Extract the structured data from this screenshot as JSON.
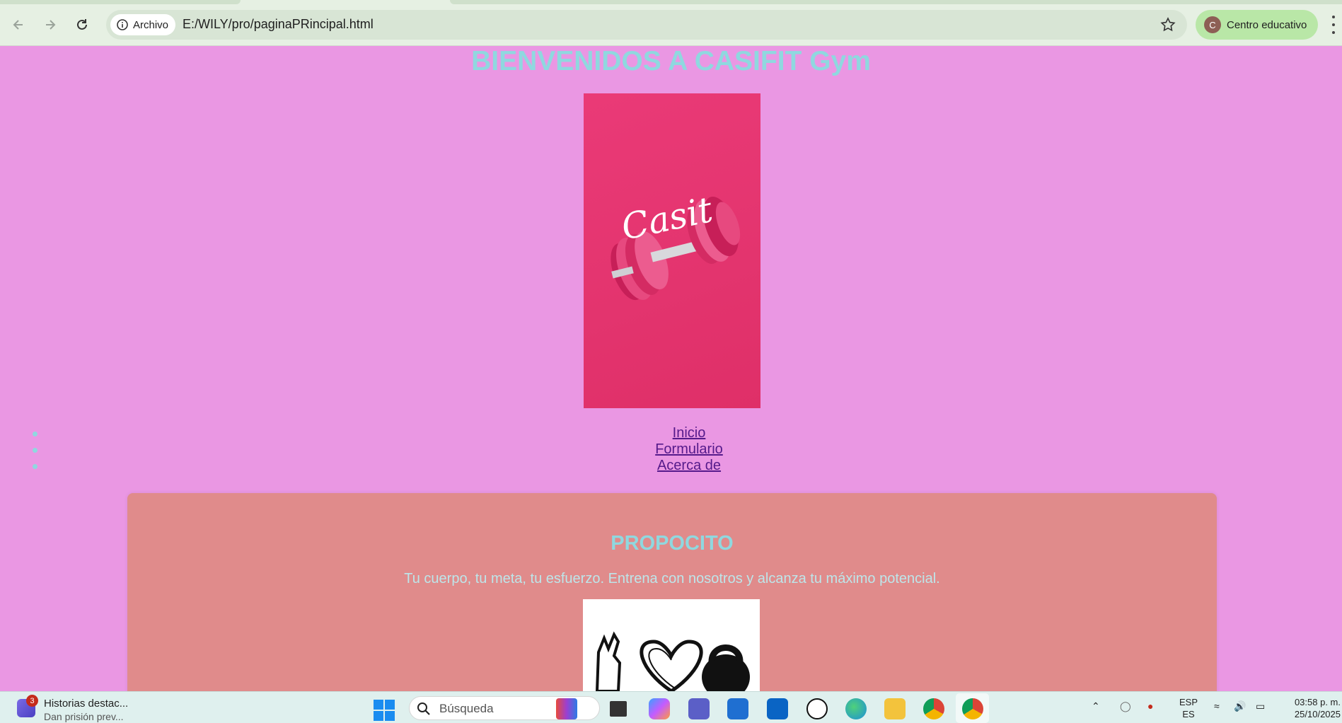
{
  "browser": {
    "chip_label": "Archivo",
    "url": "E:/WILY/pro/paginaPRincipal.html",
    "profile_label": "Centro educativo",
    "profile_initial": "C"
  },
  "page": {
    "title": "BIENVENIDOS A CASIFIT Gym",
    "hero_logo_text": "Casit",
    "nav": [
      "Inicio",
      "Formulario",
      "Acerca de"
    ],
    "card": {
      "title": "PROPOCITO",
      "text": "Tu cuerpo, tu meta, tu esfuerzo. Entrena con nosotros y alcanza tu máximo potencial."
    }
  },
  "taskbar": {
    "news_badge": "3",
    "news_title": "Historias destac...",
    "news_subtitle": "Dan prisión prev...",
    "search_placeholder": "Búsqueda",
    "lang_top": "ESP",
    "lang_bottom": "ES",
    "time": "03:58 p. m.",
    "date": "25/10/2025",
    "apps": [
      "copilot-icon",
      "file-explorer-icon",
      "teams-icon",
      "store-icon",
      "outlook-icon",
      "dell-icon",
      "edge-icon",
      "folder-icon",
      "chrome-icon",
      "chrome-profile-icon"
    ]
  },
  "colors": {
    "page_background": "#ea97e3",
    "title_color": "#8fd8df",
    "card_background": "#e08b8b",
    "link_color": "#551a8b",
    "hero_background": "#e3346e"
  }
}
